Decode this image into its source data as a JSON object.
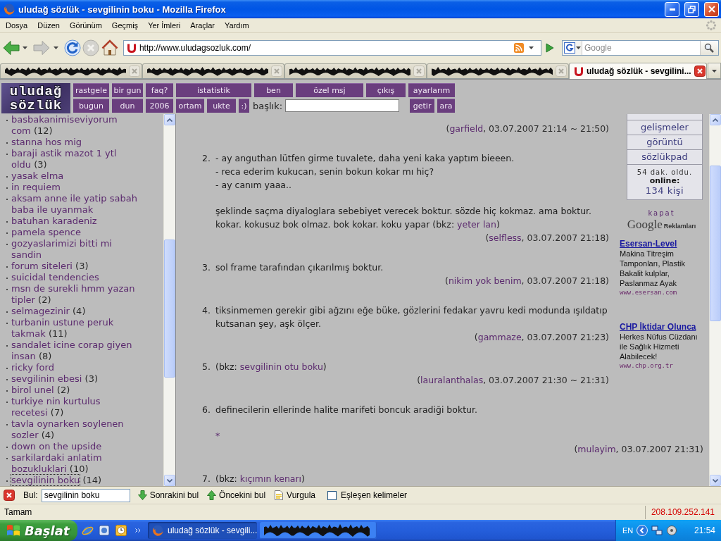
{
  "window": {
    "title": "uludağ sözlük - sevgilinin boku - Mozilla Firefox"
  },
  "menu": [
    "Dosya",
    "Düzen",
    "Görünüm",
    "Geçmiş",
    "Yer İmleri",
    "Araçlar",
    "Yardım"
  ],
  "navigation": {
    "buttons": [
      {
        "kind": "back",
        "disabled": false
      },
      {
        "kind": "forward",
        "disabled": true
      },
      {
        "kind": "reload",
        "disabled": false
      },
      {
        "kind": "stop",
        "disabled": true
      },
      {
        "kind": "home",
        "disabled": false
      }
    ],
    "url": "http://www.uludagsozluk.com/",
    "search_placeholder": "Google"
  },
  "tabs": [
    {
      "redacted": true,
      "selected": false
    },
    {
      "redacted": true,
      "selected": false
    },
    {
      "redacted": true,
      "selected": false
    },
    {
      "redacted": true,
      "selected": false
    },
    {
      "redacted": false,
      "title": "uludağ sözlük - sevgilini...",
      "selected": true
    }
  ],
  "site_header": {
    "logo": [
      "uludağ",
      "sözlük"
    ],
    "row_1": [
      "rastgele",
      "bir gun",
      "faq?",
      "istatistik",
      "ben",
      "özel msj",
      "çıkış",
      "ayarlarım"
    ],
    "row_2": [
      "bugun",
      "dun",
      "2006",
      "ortam",
      "ukte",
      ":)"
    ],
    "search_label": "başlık:",
    "search_buttons": [
      "getir",
      "ara"
    ]
  },
  "sidebar": {
    "items": [
      {
        "title": "basbakanimiseviyorum com",
        "count": "(12)",
        "selected": false
      },
      {
        "title": "stanna hos mig",
        "selected": false
      },
      {
        "title": "baraji astik mazot 1 ytl oldu",
        "count": "(3)",
        "selected": false
      },
      {
        "title": "yasak elma",
        "selected": false
      },
      {
        "title": "in requiem",
        "selected": false
      },
      {
        "title": "aksam anne ile yatip sabah baba ile uyanmak",
        "selected": false
      },
      {
        "title": "batuhan karadeniz",
        "selected": false
      },
      {
        "title": "pamela spence",
        "selected": false
      },
      {
        "title": "gozyaslarimizi bitti mi sandin",
        "selected": false
      },
      {
        "title": "forum siteleri",
        "count": "(3)",
        "selected": false
      },
      {
        "title": "suicidal tendencies",
        "selected": false
      },
      {
        "title": "msn de surekli hmm yazan tipler",
        "count": "(2)",
        "selected": false
      },
      {
        "title": "selmagezinir",
        "count": "(4)",
        "selected": false
      },
      {
        "title": "turbanin ustune peruk takmak",
        "count": "(11)",
        "selected": false
      },
      {
        "title": "sandalet icine corap giyen insan",
        "count": "(8)",
        "selected": false
      },
      {
        "title": "ricky ford",
        "selected": false
      },
      {
        "title": "sevgilinin ebesi",
        "count": "(3)",
        "selected": false
      },
      {
        "title": "birol unel",
        "count": "(2)",
        "selected": false
      },
      {
        "title": "turkiye nin kurtulus recetesi",
        "count": "(7)",
        "selected": false
      },
      {
        "title": "tavla oynarken soylenen sozler",
        "count": "(4)",
        "selected": false
      },
      {
        "title": "down on the upside",
        "selected": false
      },
      {
        "title": "sarkilardaki anlatim bozukluklari",
        "count": "(10)",
        "selected": false
      },
      {
        "title": "sevgilinin boku",
        "count": "(14)",
        "selected": true
      }
    ]
  },
  "entries": [
    {
      "signature": [
        {
          "kind": "text",
          "text": "("
        },
        {
          "kind": "link",
          "text": "garfield"
        },
        {
          "kind": "text",
          "text": ", 03.07.2007 21:14 ~ 21:50)"
        }
      ]
    },
    {
      "number": "2.",
      "paragraphs": [
        [
          [
            {
              "kind": "text",
              "text": "- ay anguthan lütfen girme tuvalete, daha yeni kaka yaptım bieeen."
            }
          ],
          [
            {
              "kind": "text",
              "text": "- reca ederim kukucan, senin bokun kokar mı hiç?"
            }
          ],
          [
            {
              "kind": "text",
              "text": "- ay canım yaaa.."
            }
          ]
        ],
        [
          [
            {
              "kind": "text",
              "text": "şeklinde saçma diyaloglara sebebiyet verecek boktur. sözde hiç kokmaz. ama boktur."
            }
          ],
          [
            {
              "kind": "text",
              "text": "kokar. kokusuz bok olmaz. bok kokar. koku yapar (bkz: "
            },
            {
              "kind": "link",
              "text": "yeter lan"
            },
            {
              "kind": "text",
              "text": ")"
            }
          ]
        ]
      ],
      "signature": [
        {
          "kind": "text",
          "text": "("
        },
        {
          "kind": "link",
          "text": "selfless"
        },
        {
          "kind": "text",
          "text": ", 03.07.2007 21:18)"
        }
      ]
    },
    {
      "number": "3.",
      "paragraphs": [
        [
          [
            {
              "kind": "text",
              "text": "sol frame tarafından çıkarılmış boktur."
            }
          ]
        ]
      ],
      "signature": [
        {
          "kind": "text",
          "text": "("
        },
        {
          "kind": "link",
          "text": "nikim yok benim"
        },
        {
          "kind": "text",
          "text": ", 03.07.2007 21:18)"
        }
      ]
    },
    {
      "number": "4.",
      "paragraphs": [
        [
          [
            {
              "kind": "text",
              "text": "tiksinmemen gerekir gibi ağzını eğe büke, gözlerini fedakar yavru kedi modunda ışıldatıp"
            }
          ],
          [
            {
              "kind": "text",
              "text": "kutsanan şey, aşk ölçer."
            }
          ]
        ]
      ],
      "signature": [
        {
          "kind": "text",
          "text": "("
        },
        {
          "kind": "link",
          "text": "gammaze"
        },
        {
          "kind": "text",
          "text": ", 03.07.2007 21:23)"
        }
      ]
    },
    {
      "number": "5.",
      "paragraphs": [
        [
          [
            {
              "kind": "text",
              "text": "(bkz: "
            },
            {
              "kind": "link",
              "text": "sevgilinin otu boku"
            },
            {
              "kind": "text",
              "text": ")"
            }
          ]
        ]
      ],
      "signature": [
        {
          "kind": "text",
          "text": "("
        },
        {
          "kind": "link",
          "text": "lauralanthalas"
        },
        {
          "kind": "text",
          "text": ", 03.07.2007 21:30 ~ 21:31)"
        }
      ]
    },
    {
      "number": "6.",
      "paragraphs": [
        [
          [
            {
              "kind": "text",
              "text": "definecilerin ellerinde halite marifeti boncuk aradiği boktur."
            }
          ]
        ],
        [
          [
            {
              "kind": "link",
              "text": "*"
            }
          ]
        ]
      ],
      "signature": [
        {
          "kind": "text",
          "text": "("
        },
        {
          "kind": "link",
          "text": "mulayim"
        },
        {
          "kind": "text",
          "text": ", 03.07.2007 21:31)"
        }
      ]
    },
    {
      "number": "7.",
      "paragraphs": [
        [
          [
            {
              "kind": "text",
              "text": "(bkz: "
            },
            {
              "kind": "link",
              "text": "kıçımın kenarı"
            },
            {
              "kind": "text",
              "text": ")"
            }
          ]
        ]
      ]
    }
  ],
  "side_box": {
    "links": [
      "gelişmeler",
      "görüntü",
      "sözlükpad"
    ],
    "uptime": "54 dak. oldu.",
    "online_label": "online:",
    "online_count": "134 kişi"
  },
  "ads": {
    "close": "kapat",
    "brand": "Google",
    "label": "Reklamları",
    "items": [
      {
        "title": "Esersan-Level",
        "text": "Makina Titreşim Tamponları, Plastik Bakalit kulplar, Paslanmaz Ayak",
        "url": "www.esersan.com"
      },
      {
        "title": "CHP İktidar Olunca",
        "text": "Herkes Nüfus Cüzdanı ile Sağlık Hizmeti Alabilecek!",
        "url": "www.chp.org.tr"
      }
    ]
  },
  "find_bar": {
    "label": "Bul:",
    "value": "sevgilinin boku",
    "buttons": [
      {
        "kind": "next",
        "label": "Sonrakini bul"
      },
      {
        "kind": "previous",
        "label": "Öncekini bul"
      },
      {
        "kind": "highlight",
        "label": "Vurgula"
      }
    ],
    "match_case": {
      "label": "Eşleşen kelimeler",
      "checked": false
    }
  },
  "status_bar": {
    "text": "Tamam",
    "address": "208.109.252.141"
  },
  "taskbar": {
    "start": "Başlat",
    "tasks": [
      {
        "redacted": false,
        "title": "uludağ sözlük - sevgili...",
        "selected": true
      },
      {
        "redacted": true,
        "selected": false
      }
    ],
    "language": "EN",
    "clock": "21:54"
  }
}
